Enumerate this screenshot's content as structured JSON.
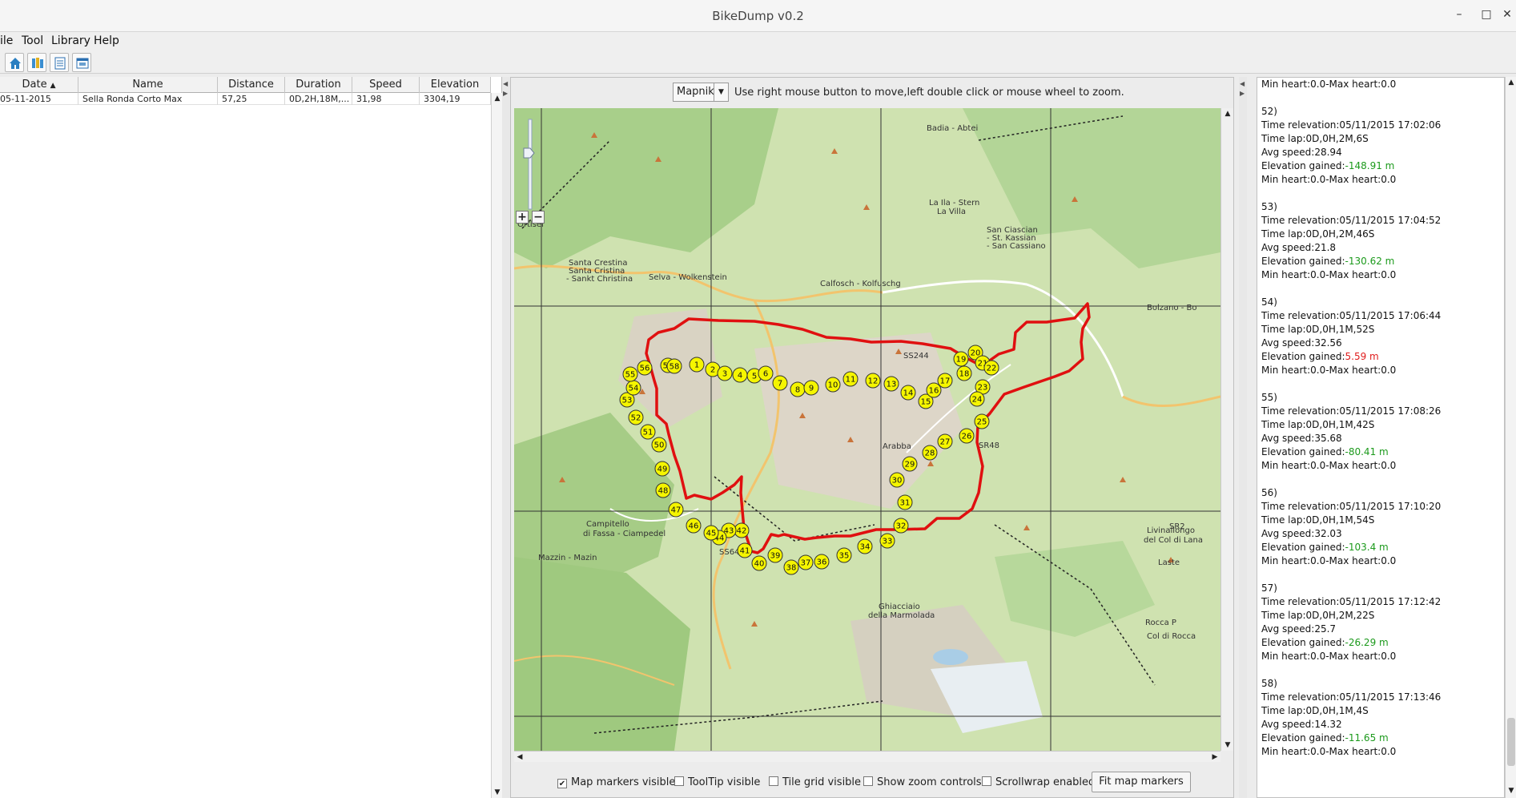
{
  "window": {
    "title": "BikeDump v0.2",
    "controls": [
      "–",
      "□",
      "✕"
    ]
  },
  "menu": [
    "ile",
    "Tool",
    "Library",
    "Help"
  ],
  "toolbar": [
    "home-icon",
    "library-icon",
    "document-icon",
    "window-icon"
  ],
  "table": {
    "columns": [
      "Date",
      "Name",
      "Distance",
      "Duration",
      "Speed",
      "Elevation"
    ],
    "rows": [
      {
        "date": "05-11-2015",
        "name": "Sella Ronda Corto Max",
        "distance": "57,25",
        "duration": "0D,2H,18M,...",
        "speed": "31,98",
        "elevation": "3304,19"
      }
    ]
  },
  "map": {
    "provider": "Mapnik",
    "hint": "Use right mouse button to move,left double click or mouse wheel to zoom.",
    "zoom_in": "+",
    "zoom_out": "−",
    "places": [
      "Badia - Abtei",
      "La Ila - Stern",
      "La Villa",
      "San Ciascian",
      "- St. Kassian",
      "- San Cassiano",
      "Santa Crestina",
      "Santa Cristina",
      "- Sankt Christina",
      "Selva - Wolkenstein",
      "Calfosch - Kolfuschg",
      "SS244",
      "SR48",
      "SS641",
      "Campitello",
      "di Fassa - Ciampedel",
      "Mazzin - Mazin",
      "Livinallongo",
      "del Col di Lana",
      "Laste",
      "Rocca P",
      "Col di Rocca",
      "Arabba",
      "Ghiacciaio",
      "della Marmolada",
      "Ortisei",
      "Bolzano - Bo",
      "SR2"
    ],
    "markers": [
      "1",
      "2",
      "3",
      "4",
      "5",
      "6",
      "7",
      "8",
      "9",
      "10",
      "11",
      "12",
      "13",
      "14",
      "15",
      "16",
      "17",
      "18",
      "19",
      "20",
      "21",
      "22",
      "23",
      "24",
      "25",
      "26",
      "27",
      "28",
      "29",
      "30",
      "31",
      "32",
      "33",
      "34",
      "35",
      "36",
      "37",
      "38",
      "39",
      "40",
      "41",
      "42",
      "43",
      "44",
      "45",
      "46",
      "47",
      "48",
      "49",
      "50",
      "51",
      "52",
      "53",
      "54",
      "55",
      "56",
      "57",
      "58"
    ],
    "options": {
      "markers_visible": {
        "label": "Map markers visible",
        "checked": true
      },
      "tooltip_visible": {
        "label": "ToolTip visible",
        "checked": false
      },
      "tile_grid_visible": {
        "label": "Tile grid visible",
        "checked": false
      },
      "zoom_controls": {
        "label": "Show zoom controls",
        "checked": false
      },
      "scrollwrap": {
        "label": "Scrollwrap enabled",
        "checked": false
      }
    },
    "fit_button": "Fit map markers"
  },
  "laps_header": "Min heart:0.0-Max heart:0.0",
  "laps": [
    {
      "num": "52)",
      "time": "Time relevation:05/11/2015 17:02:06",
      "lap": "Time lap:0D,0H,2M,6S",
      "avg": "Avg speed:28.94",
      "elev_label": "Elevation gained:",
      "elev": "-148.91 m",
      "sign": "neg",
      "heart": "Min heart:0.0-Max heart:0.0"
    },
    {
      "num": "53)",
      "time": "Time relevation:05/11/2015 17:04:52",
      "lap": "Time lap:0D,0H,2M,46S",
      "avg": "Avg speed:21.8",
      "elev_label": "Elevation gained:",
      "elev": "-130.62 m",
      "sign": "neg",
      "heart": "Min heart:0.0-Max heart:0.0"
    },
    {
      "num": "54)",
      "time": "Time relevation:05/11/2015 17:06:44",
      "lap": "Time lap:0D,0H,1M,52S",
      "avg": "Avg speed:32.56",
      "elev_label": "Elevation gained:",
      "elev": "5.59 m",
      "sign": "pos",
      "heart": "Min heart:0.0-Max heart:0.0"
    },
    {
      "num": "55)",
      "time": "Time relevation:05/11/2015 17:08:26",
      "lap": "Time lap:0D,0H,1M,42S",
      "avg": "Avg speed:35.68",
      "elev_label": "Elevation gained:",
      "elev": "-80.41 m",
      "sign": "neg",
      "heart": "Min heart:0.0-Max heart:0.0"
    },
    {
      "num": "56)",
      "time": "Time relevation:05/11/2015 17:10:20",
      "lap": "Time lap:0D,0H,1M,54S",
      "avg": "Avg speed:32.03",
      "elev_label": "Elevation gained:",
      "elev": "-103.4 m",
      "sign": "neg",
      "heart": "Min heart:0.0-Max heart:0.0"
    },
    {
      "num": "57)",
      "time": "Time relevation:05/11/2015 17:12:42",
      "lap": "Time lap:0D,0H,2M,22S",
      "avg": "Avg speed:25.7",
      "elev_label": "Elevation gained:",
      "elev": "-26.29 m",
      "sign": "neg",
      "heart": "Min heart:0.0-Max heart:0.0"
    },
    {
      "num": "58)",
      "time": "Time relevation:05/11/2015 17:13:46",
      "lap": "Time lap:0D,0H,1M,4S",
      "avg": "Avg speed:14.32",
      "elev_label": "Elevation gained:",
      "elev": "-11.65 m",
      "sign": "neg",
      "heart": "Min heart:0.0-Max heart:0.0"
    }
  ]
}
